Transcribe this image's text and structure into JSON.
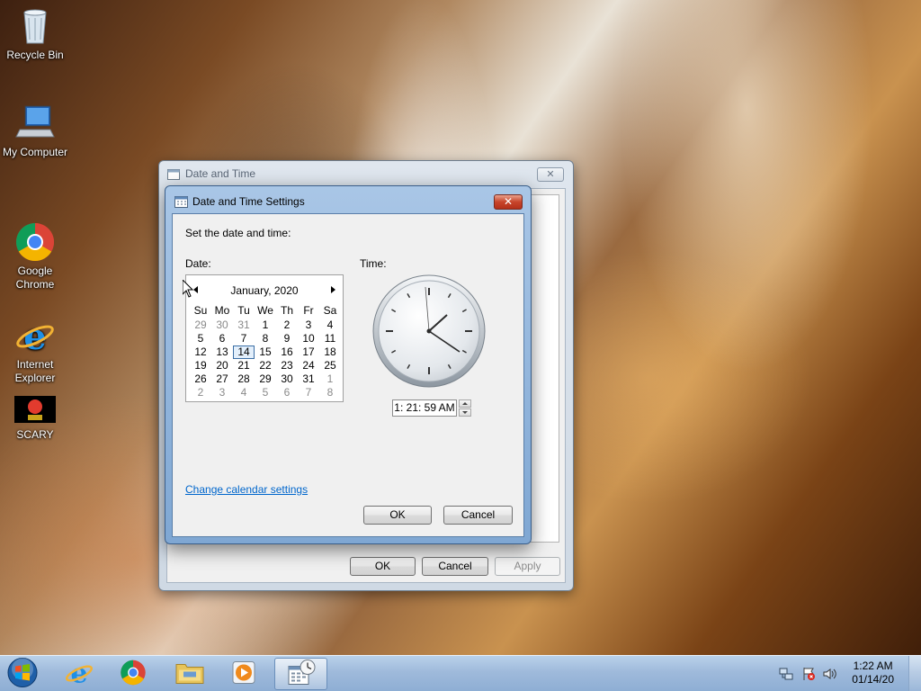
{
  "desktop": {
    "icons": [
      {
        "label": "Recycle Bin",
        "icon": "recycle-bin-icon"
      },
      {
        "label": "My Computer",
        "icon": "computer-icon"
      },
      {
        "label": "Google\nChrome",
        "icon": "chrome-icon"
      },
      {
        "label": "Internet\nExplorer",
        "icon": "internet-explorer-icon"
      },
      {
        "label": "SCARY",
        "icon": "game-shortcut-icon"
      }
    ]
  },
  "outer_window": {
    "title": "Date and Time",
    "buttons": {
      "ok": "OK",
      "cancel": "Cancel",
      "apply": "Apply"
    }
  },
  "dialog": {
    "title": "Date and Time Settings",
    "prompt": "Set the date and time:",
    "date_label": "Date:",
    "time_label": "Time:",
    "calendar": {
      "month_year": "January, 2020",
      "weekdays": [
        "Su",
        "Mo",
        "Tu",
        "We",
        "Th",
        "Fr",
        "Sa"
      ],
      "weeks": [
        [
          "29",
          "30",
          "31",
          "1",
          "2",
          "3",
          "4"
        ],
        [
          "5",
          "6",
          "7",
          "8",
          "9",
          "10",
          "11"
        ],
        [
          "12",
          "13",
          "14",
          "15",
          "16",
          "17",
          "18"
        ],
        [
          "19",
          "20",
          "21",
          "22",
          "23",
          "24",
          "25"
        ],
        [
          "26",
          "27",
          "28",
          "29",
          "30",
          "31",
          "1"
        ],
        [
          "2",
          "3",
          "4",
          "5",
          "6",
          "7",
          "8"
        ]
      ],
      "selected_day": "14"
    },
    "time_value": "1: 21: 59 AM",
    "link": "Change calendar settings",
    "ok": "OK",
    "cancel": "Cancel"
  },
  "taskbar": {
    "clock_time": "1:22 AM",
    "clock_date": "01/14/20",
    "apps": [
      "start-orb-icon",
      "internet-explorer-icon",
      "chrome-icon",
      "file-explorer-icon",
      "media-player-icon",
      "date-time-icon"
    ]
  },
  "colors": {
    "link": "#0066cc",
    "dialog_frame": "#8fb1d9",
    "close_red": "#c7442a"
  }
}
